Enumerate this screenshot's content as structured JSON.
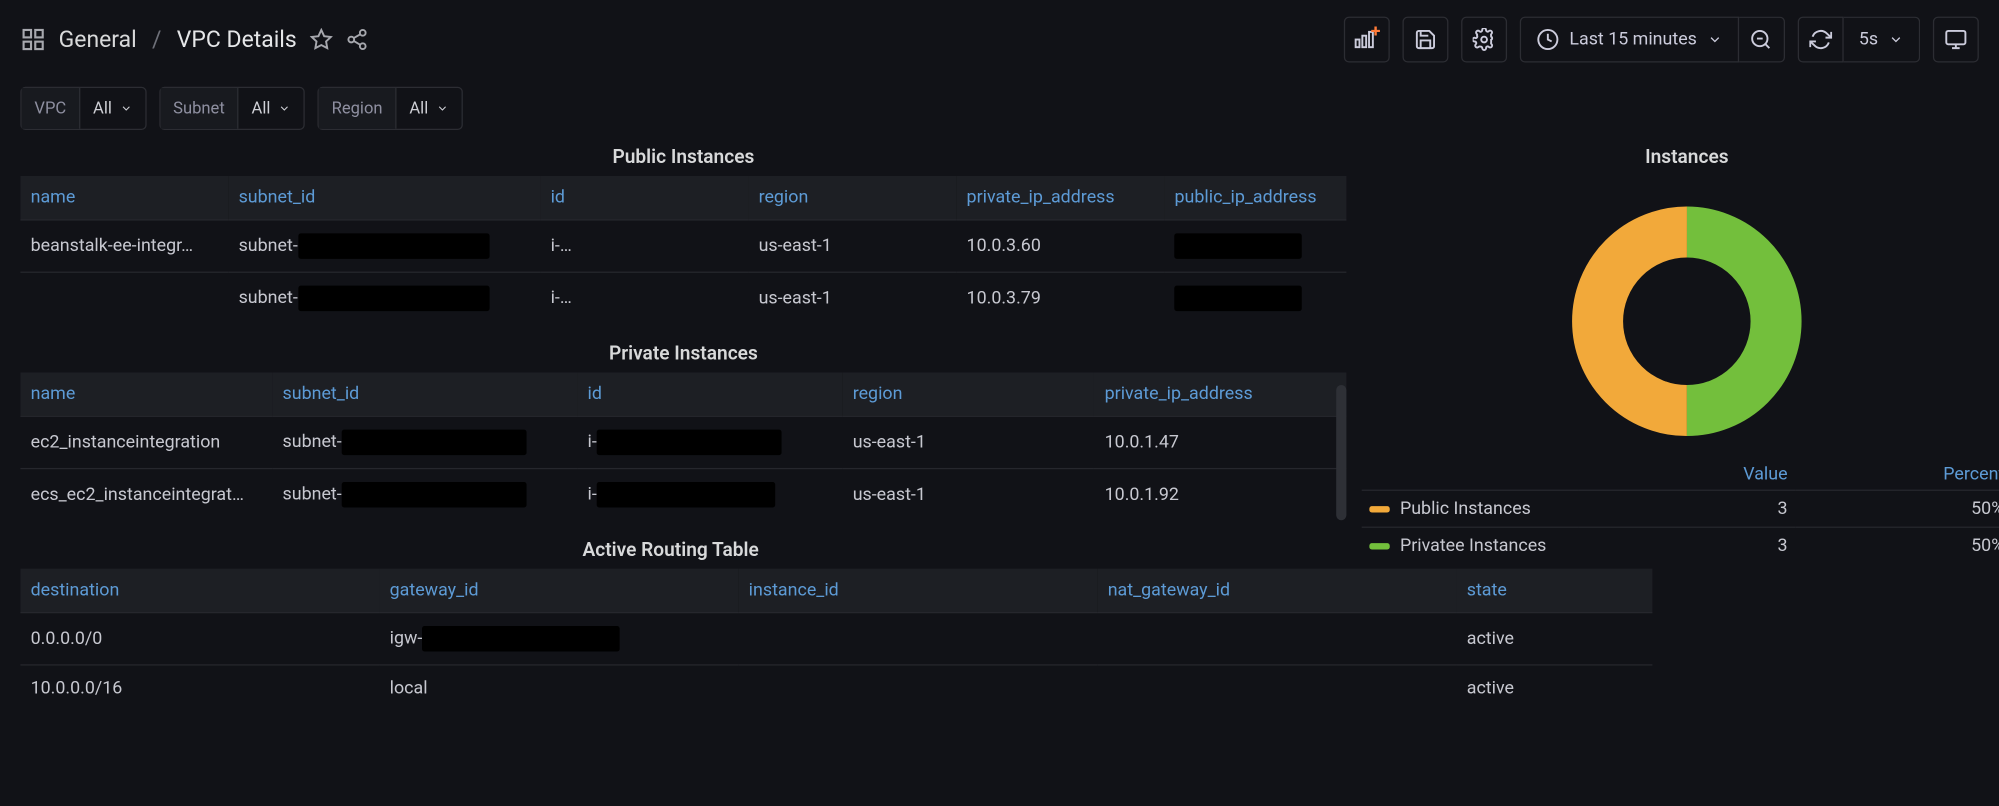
{
  "header": {
    "folder": "General",
    "title": "VPC Details",
    "time_label": "Last 15 minutes",
    "refresh_interval": "5s"
  },
  "variables": [
    {
      "label": "VPC",
      "value": "All"
    },
    {
      "label": "Subnet",
      "value": "All"
    },
    {
      "label": "Region",
      "value": "All"
    }
  ],
  "panels": {
    "public": {
      "title": "Public Instances",
      "columns": [
        "name",
        "subnet_id",
        "id",
        "region",
        "private_ip_address",
        "public_ip_address"
      ],
      "rows": [
        {
          "name": "beanstalk-ee-integr…",
          "subnet_prefix": "subnet-",
          "id_prefix": "i-",
          "region": "us-east-1",
          "private_ip": "10.0.3.60",
          "public_ip": ""
        },
        {
          "name": "",
          "subnet_prefix": "subnet-",
          "id_prefix": "i-",
          "region": "us-east-1",
          "private_ip": "10.0.3.79",
          "public_ip": ""
        }
      ]
    },
    "private": {
      "title": "Private Instances",
      "columns": [
        "name",
        "subnet_id",
        "id",
        "region",
        "private_ip_address"
      ],
      "rows": [
        {
          "name": "ec2_instanceintegration",
          "subnet_prefix": "subnet-",
          "id_prefix": "i-",
          "region": "us-east-1",
          "private_ip": "10.0.1.47"
        },
        {
          "name": "ecs_ec2_instanceintegrat…",
          "subnet_prefix": "subnet-",
          "id_prefix": "i-",
          "region": "us-east-1",
          "private_ip": "10.0.1.92"
        }
      ]
    },
    "routing": {
      "title": "Active Routing Table",
      "columns": [
        "destination",
        "gateway_id",
        "instance_id",
        "nat_gateway_id",
        "state"
      ],
      "rows": [
        {
          "destination": "0.0.0.0/0",
          "gateway_prefix": "igw-",
          "instance_id": "",
          "nat_gateway_id": "",
          "state": "active"
        },
        {
          "destination": "10.0.0.0/16",
          "gateway_prefix": "local",
          "gateway_redact": false,
          "instance_id": "",
          "nat_gateway_id": "",
          "state": "active"
        }
      ]
    },
    "instances_chart": {
      "title": "Instances",
      "legend_headers": [
        "",
        "Value",
        "Percent"
      ],
      "items": [
        {
          "label": "Public Instances",
          "value": "3",
          "percent": "50%",
          "color": "#f2a93a"
        },
        {
          "label": "Privatee Instances",
          "value": "3",
          "percent": "50%",
          "color": "#73bf3c"
        }
      ]
    }
  },
  "chart_data": {
    "type": "pie",
    "title": "Instances",
    "series": [
      {
        "name": "Public Instances",
        "value": 3,
        "percent": 50,
        "color": "#f2a93a"
      },
      {
        "name": "Privatee Instances",
        "value": 3,
        "percent": 50,
        "color": "#73bf3c"
      }
    ]
  }
}
